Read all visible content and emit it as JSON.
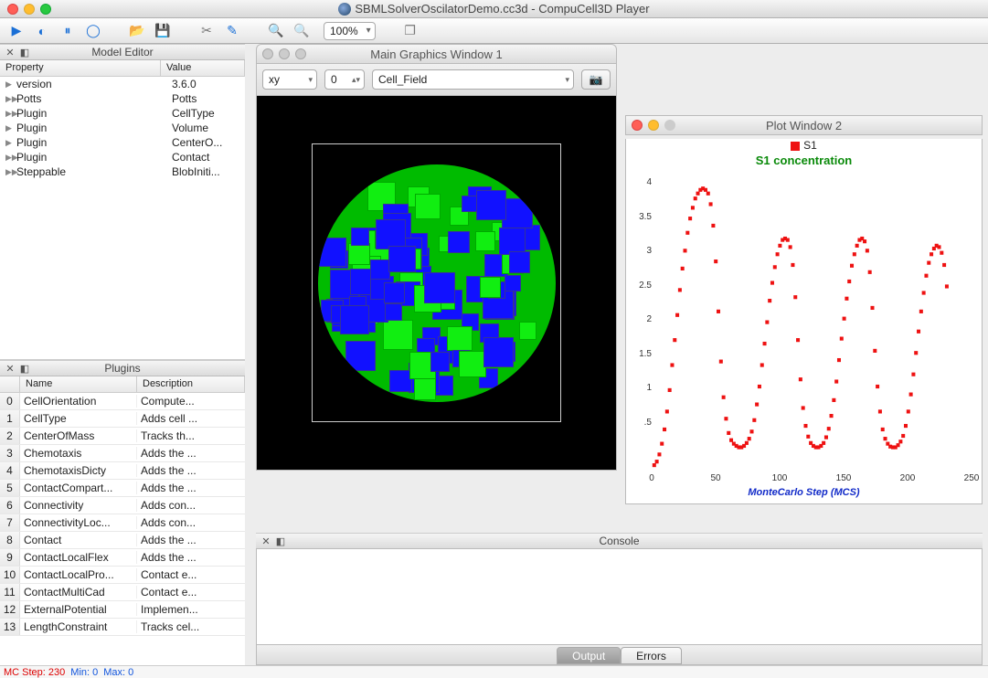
{
  "window": {
    "title": "SBMLSolverOscilatorDemo.cc3d - CompuCell3D Player"
  },
  "toolbar": {
    "zoom": "100%"
  },
  "model_editor": {
    "title": "Model Editor",
    "cols": {
      "prop": "Property",
      "val": "Value"
    },
    "rows": [
      {
        "tri": false,
        "prop": "version",
        "val": "3.6.0"
      },
      {
        "tri": true,
        "prop": "Potts",
        "val": "Potts"
      },
      {
        "tri": true,
        "prop": "Plugin",
        "val": "CellType"
      },
      {
        "tri": false,
        "prop": "Plugin",
        "val": "Volume"
      },
      {
        "tri": false,
        "prop": "Plugin",
        "val": "CenterO..."
      },
      {
        "tri": true,
        "prop": "Plugin",
        "val": "Contact"
      },
      {
        "tri": true,
        "prop": "Steppable",
        "val": "BlobIniti..."
      }
    ]
  },
  "plugins": {
    "title": "Plugins",
    "cols": {
      "idx": "",
      "name": "Name",
      "desc": "Description"
    },
    "rows": [
      {
        "idx": "0",
        "name": "CellOrientation",
        "desc": "Compute..."
      },
      {
        "idx": "1",
        "name": "CellType",
        "desc": "Adds cell ..."
      },
      {
        "idx": "2",
        "name": "CenterOfMass",
        "desc": "Tracks th..."
      },
      {
        "idx": "3",
        "name": "Chemotaxis",
        "desc": "Adds the ..."
      },
      {
        "idx": "4",
        "name": "ChemotaxisDicty",
        "desc": "Adds the ..."
      },
      {
        "idx": "5",
        "name": "ContactCompart...",
        "desc": "Adds the ..."
      },
      {
        "idx": "6",
        "name": "Connectivity",
        "desc": "Adds con..."
      },
      {
        "idx": "7",
        "name": "ConnectivityLoc...",
        "desc": "Adds con..."
      },
      {
        "idx": "8",
        "name": "Contact",
        "desc": "Adds the ..."
      },
      {
        "idx": "9",
        "name": "ContactLocalFlex",
        "desc": "Adds the ..."
      },
      {
        "idx": "10",
        "name": "ContactLocalPro...",
        "desc": "Contact e..."
      },
      {
        "idx": "11",
        "name": "ContactMultiCad",
        "desc": "Contact e..."
      },
      {
        "idx": "12",
        "name": "ExternalPotential",
        "desc": "Implemen..."
      },
      {
        "idx": "13",
        "name": "LengthConstraint",
        "desc": "Tracks cel..."
      }
    ]
  },
  "graphics": {
    "title": "Main Graphics Window 1",
    "proj": "xy",
    "slice": "0",
    "field": "Cell_Field"
  },
  "plot": {
    "title": "Plot Window 2",
    "legend": "S1",
    "chart_title": "S1 concentration",
    "xlabel": "MonteCarlo Step (MCS)"
  },
  "console": {
    "title": "Console",
    "tabs": {
      "output": "Output",
      "errors": "Errors"
    }
  },
  "status": {
    "mc_label": "MC Step:",
    "mc_val": "230",
    "min": "Min: 0",
    "max": "Max: 0"
  },
  "chart_data": {
    "type": "scatter",
    "title": "S1 concentration",
    "xlabel": "MonteCarlo Step (MCS)",
    "ylabel": "",
    "xlim": [
      0,
      250
    ],
    "ylim": [
      0,
      4
    ],
    "xticks": [
      0,
      50,
      100,
      150,
      200,
      250
    ],
    "yticks": [
      0.5,
      1,
      1.5,
      2,
      2.5,
      3,
      3.5,
      4
    ],
    "legend": [
      "S1"
    ],
    "series": [
      {
        "name": "S1",
        "x": [
          2,
          4,
          6,
          8,
          10,
          12,
          14,
          16,
          18,
          20,
          22,
          24,
          26,
          28,
          30,
          32,
          34,
          36,
          38,
          40,
          42,
          44,
          46,
          48,
          50,
          52,
          54,
          56,
          58,
          60,
          62,
          64,
          66,
          68,
          70,
          72,
          74,
          76,
          78,
          80,
          82,
          84,
          86,
          88,
          90,
          92,
          94,
          96,
          98,
          100,
          102,
          104,
          106,
          108,
          110,
          112,
          114,
          116,
          118,
          120,
          122,
          124,
          126,
          128,
          130,
          132,
          134,
          136,
          138,
          140,
          142,
          144,
          146,
          148,
          150,
          152,
          154,
          156,
          158,
          160,
          162,
          164,
          166,
          168,
          170,
          172,
          174,
          176,
          178,
          180,
          182,
          184,
          186,
          188,
          190,
          192,
          194,
          196,
          198,
          200,
          202,
          204,
          206,
          208,
          210,
          212,
          214,
          216,
          218,
          220,
          222,
          224,
          226,
          228,
          230
        ],
        "y": [
          0.05,
          0.1,
          0.2,
          0.35,
          0.55,
          0.8,
          1.1,
          1.45,
          1.8,
          2.15,
          2.5,
          2.8,
          3.05,
          3.3,
          3.5,
          3.65,
          3.78,
          3.85,
          3.9,
          3.92,
          3.9,
          3.85,
          3.7,
          3.4,
          2.9,
          2.2,
          1.5,
          1.0,
          0.7,
          0.5,
          0.4,
          0.35,
          0.32,
          0.3,
          0.3,
          0.32,
          0.36,
          0.42,
          0.52,
          0.68,
          0.9,
          1.15,
          1.45,
          1.75,
          2.05,
          2.35,
          2.6,
          2.82,
          3.0,
          3.12,
          3.2,
          3.22,
          3.2,
          3.1,
          2.85,
          2.4,
          1.8,
          1.25,
          0.85,
          0.6,
          0.45,
          0.36,
          0.32,
          0.3,
          0.3,
          0.32,
          0.36,
          0.44,
          0.56,
          0.74,
          0.96,
          1.22,
          1.52,
          1.82,
          2.1,
          2.38,
          2.62,
          2.84,
          3.0,
          3.12,
          3.2,
          3.22,
          3.18,
          3.05,
          2.75,
          2.25,
          1.65,
          1.15,
          0.8,
          0.55,
          0.42,
          0.35,
          0.31,
          0.3,
          0.3,
          0.33,
          0.38,
          0.46,
          0.6,
          0.8,
          1.04,
          1.32,
          1.62,
          1.92,
          2.2,
          2.46,
          2.7,
          2.88,
          3.0,
          3.08,
          3.12,
          3.1,
          3.02,
          2.85,
          2.55
        ]
      }
    ]
  }
}
